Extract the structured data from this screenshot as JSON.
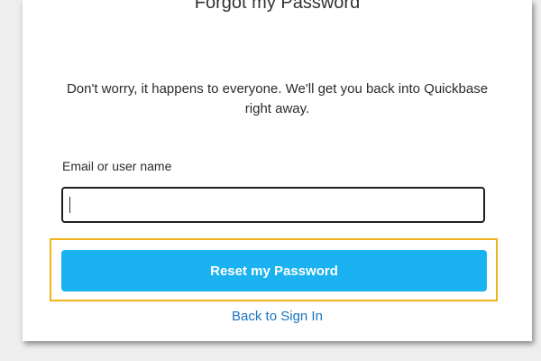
{
  "form": {
    "title": "Forgot my Password",
    "description": "Don't worry, it happens to everyone. We'll get you back into Quickbase right away.",
    "email_label": "Email or user name",
    "email_value": "",
    "email_placeholder": "",
    "reset_button_label": "Reset my Password",
    "back_link_label": "Back to Sign In"
  },
  "colors": {
    "button_bg": "#1ab2f0",
    "highlight_border": "#f0b31a",
    "link": "#1a73c2"
  }
}
